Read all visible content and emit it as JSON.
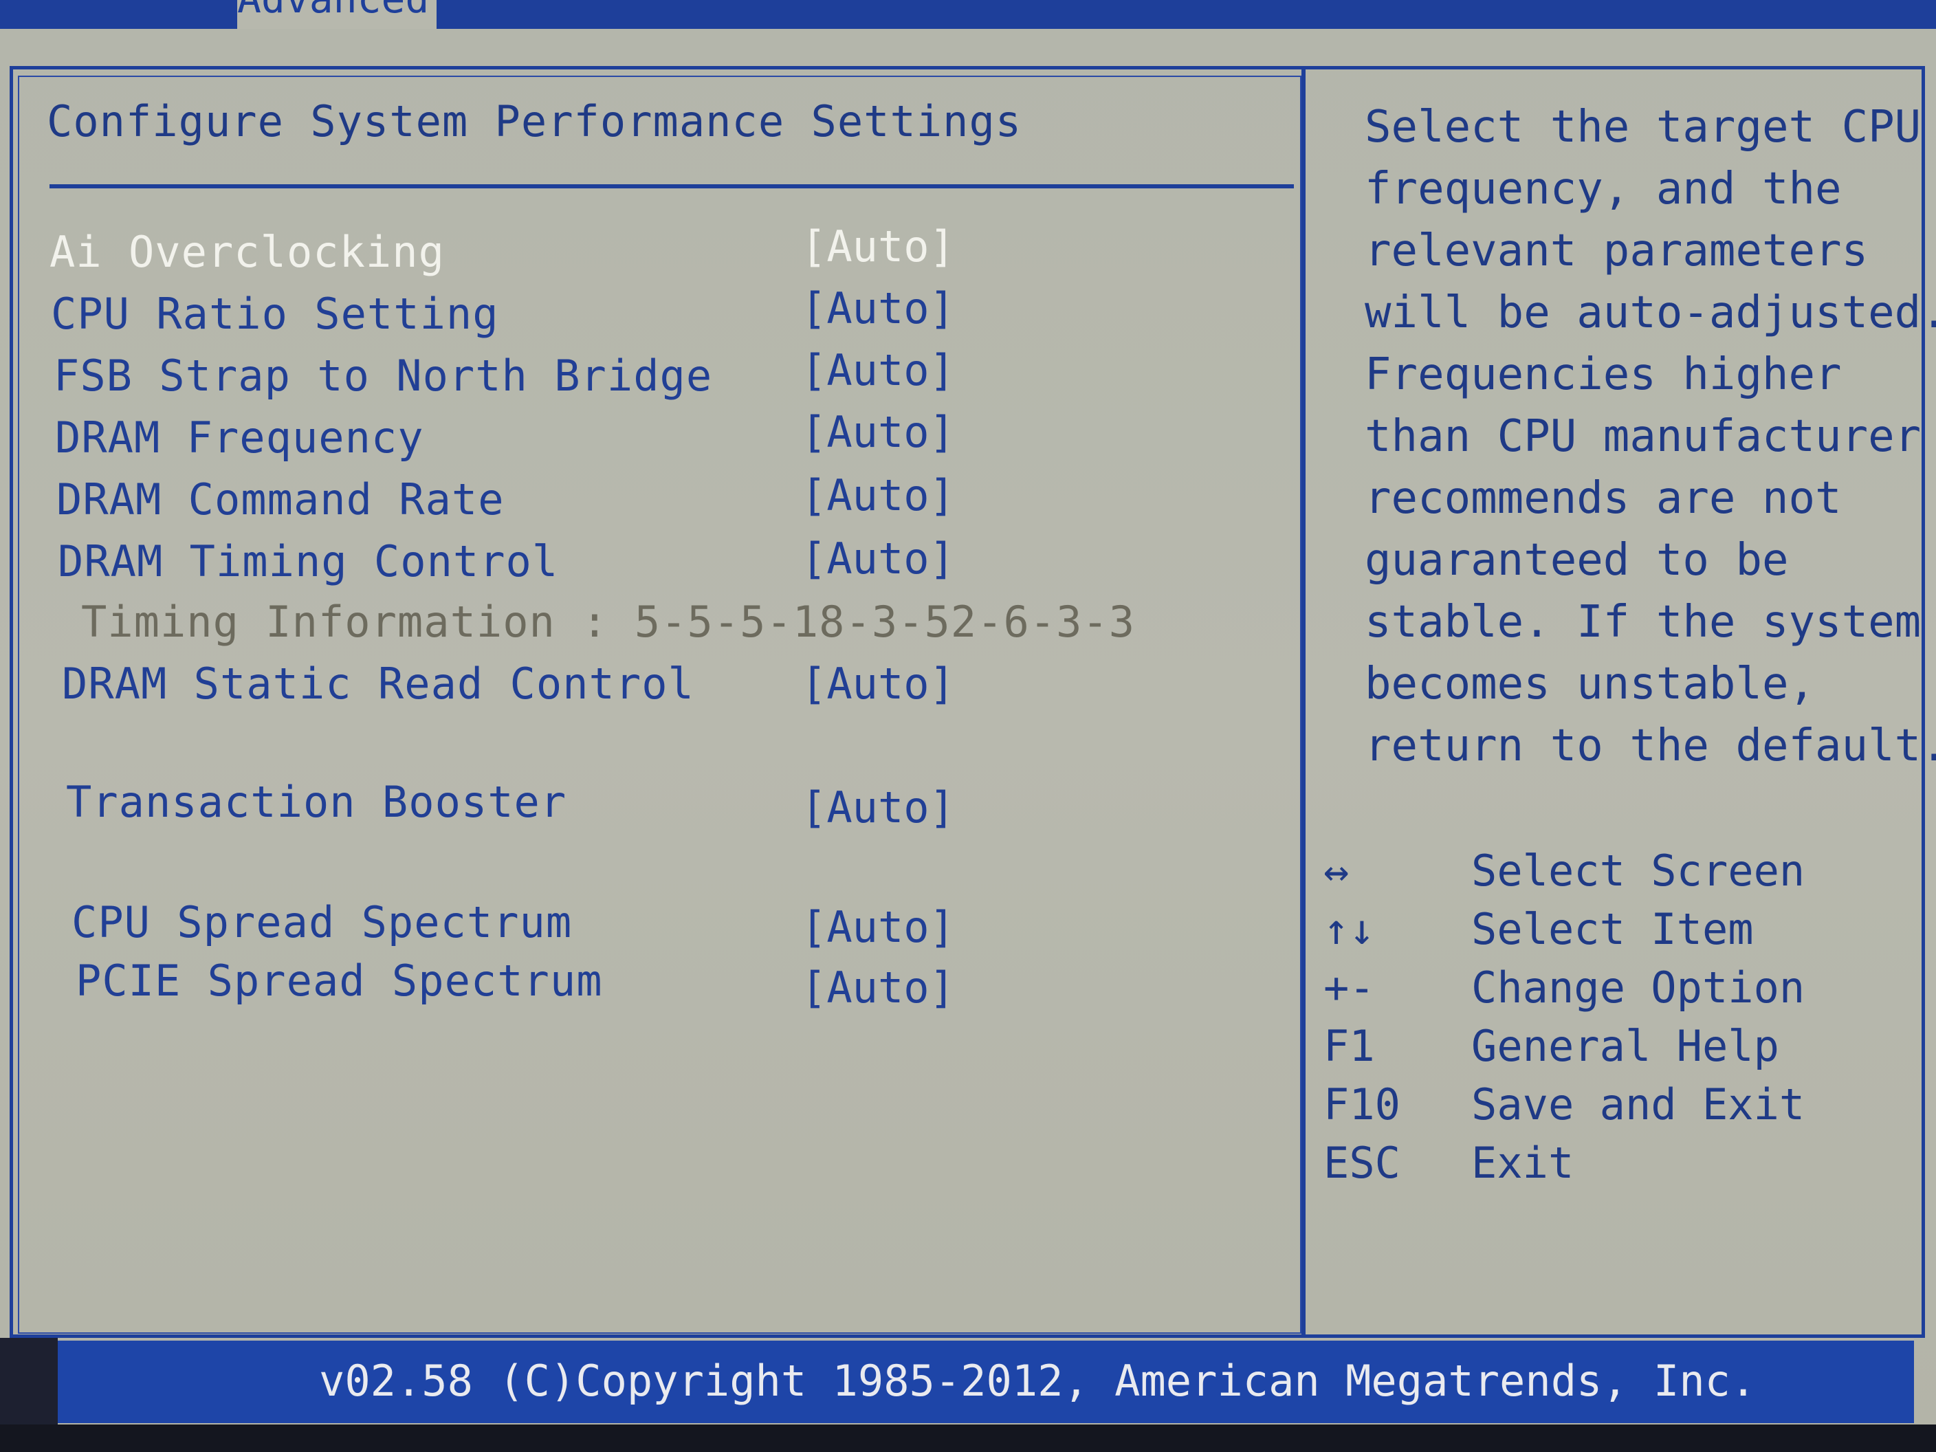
{
  "tab": {
    "label": "Advanced"
  },
  "title": "Configure System Performance Settings",
  "items": [
    {
      "label": "Ai Overclocking",
      "value": "[Auto]"
    },
    {
      "label": "CPU Ratio Setting",
      "value": "[Auto]"
    },
    {
      "label": "FSB Strap to North Bridge",
      "value": "[Auto]"
    },
    {
      "label": "DRAM Frequency",
      "value": "[Auto]"
    },
    {
      "label": "DRAM Command Rate",
      "value": "[Auto]"
    },
    {
      "label": "DRAM Timing Control",
      "value": "[Auto]"
    },
    {
      "label": "DRAM Static Read Control",
      "value": "[Auto]"
    },
    {
      "label": "Transaction Booster",
      "value": "[Auto]"
    },
    {
      "label": "CPU Spread Spectrum",
      "value": "[Auto]"
    },
    {
      "label": "PCIE Spread Spectrum",
      "value": "[Auto]"
    }
  ],
  "timing_info": "Timing Information : 5-5-5-18-3-52-6-3-3",
  "help": {
    "lines": [
      "Select the target CPU",
      "frequency, and the",
      "relevant parameters",
      "will be auto-adjusted.",
      "Frequencies higher",
      "than CPU manufacturer",
      "recommends are not",
      "guaranteed to be",
      "stable. If the system",
      "becomes unstable,",
      "return to the default."
    ]
  },
  "keys": [
    {
      "key": "↔",
      "desc": "Select Screen"
    },
    {
      "key": "↑↓",
      "desc": "Select Item"
    },
    {
      "key": "+-",
      "desc": "Change Option"
    },
    {
      "key": "F1",
      "desc": "General Help"
    },
    {
      "key": "F10",
      "desc": "Save and Exit"
    },
    {
      "key": "ESC",
      "desc": "Exit"
    }
  ],
  "footer": "v02.58 (C)Copyright 1985-2012, American Megatrends, Inc.",
  "colors": {
    "accent": "#1e3f9a",
    "background": "#b7b8ad",
    "selected_text": "#f2f2ec",
    "info_text": "#6d6b5e"
  }
}
